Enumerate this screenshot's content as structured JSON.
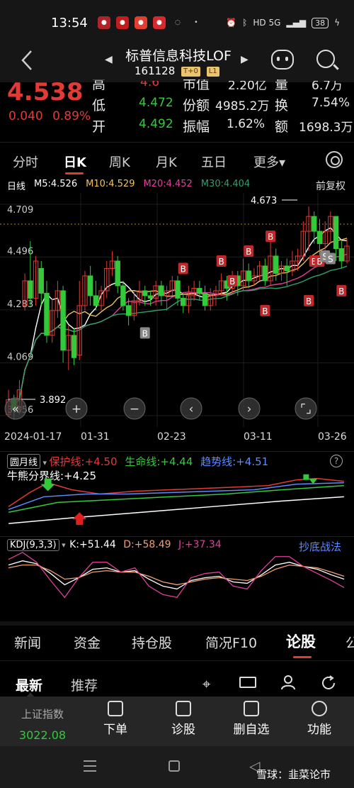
{
  "status": {
    "time": "13:54",
    "battery": "38",
    "right_text": "HD 5G"
  },
  "header": {
    "name": "标普信息科技LOF",
    "code": "161128",
    "tag1": "T+0",
    "tag2": "L1"
  },
  "quote": {
    "price": "4.538",
    "change": "0.040",
    "change_pct": "0.89%",
    "row0": [
      "高",
      "4.6",
      "市值",
      "2.20亿",
      "量",
      "6.7万"
    ],
    "low_label": "低",
    "low": "4.472",
    "amount_label": "份额",
    "amount": "4985.2万",
    "turnover_label": "换",
    "turnover": "7.54%",
    "open_label": "开",
    "open": "4.492",
    "amp_label": "振幅",
    "amp": "1.62%",
    "vol_label": "额",
    "vol": "1698.3万"
  },
  "tabs": [
    "分时",
    "日K",
    "周K",
    "月K",
    "五日",
    "更多▾"
  ],
  "ma": {
    "label": "日线",
    "m5": "M5:4.526",
    "m10": "M10:4.529",
    "m20": "M20:4.452",
    "m30": "M30:4.404",
    "adjust": "前复权"
  },
  "chart_data": {
    "type": "candlestick",
    "yticks": [
      "4.709",
      "4.496",
      "4.283",
      "4.069",
      "3.856"
    ],
    "xticks": [
      "2024-01-17",
      "01-31",
      "02-23",
      "03-11",
      "03-26"
    ],
    "high_mark": "4.673",
    "low_mark": "3.892",
    "candles": [
      [
        3.86,
        3.92,
        3.85,
        3.96
      ],
      [
        3.92,
        3.88,
        3.84,
        3.94
      ],
      [
        3.88,
        3.96,
        3.86,
        4.0
      ],
      [
        4.3,
        4.4,
        4.28,
        4.43
      ],
      [
        4.4,
        4.33,
        4.3,
        4.56
      ],
      [
        4.33,
        4.48,
        4.3,
        4.5
      ],
      [
        4.45,
        4.35,
        4.3,
        4.48
      ],
      [
        4.35,
        4.18,
        4.15,
        4.4
      ],
      [
        4.18,
        4.28,
        4.15,
        4.33
      ],
      [
        4.28,
        4.36,
        4.25,
        4.4
      ],
      [
        4.36,
        4.12,
        4.07,
        4.38
      ],
      [
        4.12,
        4.18,
        4.04,
        4.22
      ],
      [
        4.18,
        4.09,
        4.06,
        4.21
      ],
      [
        4.1,
        4.3,
        4.08,
        4.4
      ],
      [
        4.3,
        4.42,
        4.28,
        4.44
      ],
      [
        4.42,
        4.34,
        4.3,
        4.46
      ],
      [
        4.34,
        4.3,
        4.28,
        4.4
      ],
      [
        4.3,
        4.36,
        4.28,
        4.38
      ],
      [
        4.36,
        4.45,
        4.33,
        4.48
      ],
      [
        4.45,
        4.48,
        4.42,
        4.52
      ],
      [
        4.48,
        4.38,
        4.35,
        4.5
      ],
      [
        4.38,
        4.3,
        4.28,
        4.4
      ],
      [
        4.3,
        4.26,
        4.22,
        4.33
      ],
      [
        4.26,
        4.32,
        4.24,
        4.36
      ],
      [
        4.32,
        4.36,
        4.3,
        4.4
      ],
      [
        4.36,
        4.34,
        4.3,
        4.38
      ],
      [
        4.34,
        4.33,
        4.3,
        4.36
      ],
      [
        4.33,
        4.38,
        4.3,
        4.4
      ],
      [
        4.38,
        4.34,
        4.3,
        4.4
      ],
      [
        4.34,
        4.36,
        4.28,
        4.38
      ],
      [
        4.36,
        4.4,
        4.34,
        4.42
      ],
      [
        4.4,
        4.33,
        4.3,
        4.42
      ],
      [
        4.33,
        4.3,
        4.27,
        4.35
      ],
      [
        4.3,
        4.34,
        4.27,
        4.38
      ],
      [
        4.34,
        4.37,
        4.32,
        4.4
      ],
      [
        4.37,
        4.35,
        4.32,
        4.4
      ],
      [
        4.35,
        4.3,
        4.28,
        4.38
      ],
      [
        4.3,
        4.34,
        4.28,
        4.37
      ],
      [
        4.34,
        4.36,
        4.3,
        4.38
      ],
      [
        4.36,
        4.4,
        4.34,
        4.43
      ],
      [
        4.4,
        4.37,
        4.32,
        4.42
      ],
      [
        4.37,
        4.42,
        4.35,
        4.44
      ],
      [
        4.42,
        4.38,
        4.34,
        4.44
      ],
      [
        4.38,
        4.44,
        4.36,
        4.49
      ],
      [
        4.44,
        4.4,
        4.37,
        4.47
      ],
      [
        4.4,
        4.42,
        4.38,
        4.45
      ],
      [
        4.42,
        4.46,
        4.4,
        4.48
      ],
      [
        4.46,
        4.4,
        4.38,
        4.49
      ],
      [
        4.4,
        4.5,
        4.38,
        4.58
      ],
      [
        4.5,
        4.43,
        4.4,
        4.53
      ],
      [
        4.43,
        4.46,
        4.4,
        4.48
      ],
      [
        4.46,
        4.44,
        4.38,
        4.49
      ],
      [
        4.44,
        4.48,
        4.42,
        4.52
      ],
      [
        4.48,
        4.5,
        4.44,
        4.53
      ],
      [
        4.5,
        4.6,
        4.48,
        4.64
      ],
      [
        4.6,
        4.66,
        4.52,
        4.7
      ],
      [
        4.66,
        4.6,
        4.55,
        4.68
      ],
      [
        4.6,
        4.55,
        4.5,
        4.65
      ],
      [
        4.55,
        4.6,
        4.5,
        4.64
      ],
      [
        4.6,
        4.66,
        4.55,
        4.68
      ],
      [
        4.66,
        4.53,
        4.48,
        4.66
      ],
      [
        4.53,
        4.48,
        4.45,
        4.56
      ],
      [
        4.48,
        4.54,
        4.47,
        4.57
      ]
    ]
  },
  "controls": {
    "collapse": "«",
    "zoom_in": "+",
    "zoom_out": "−",
    "prev": "‹",
    "next": "›",
    "fullscreen": "⌜⌟"
  },
  "indicator1": {
    "name": "圆月线",
    "protect": "保护线:+4.50",
    "life": "生命线:+4.44",
    "trend": "趋势线:+4.51",
    "bull_bear": "牛熊分界线:+4.25",
    "help": "?"
  },
  "indicator2": {
    "name": "KDJ(9,3,3)",
    "k": "K:+51.44",
    "d": "D:+58.49",
    "j": "J:+37.34",
    "strategy": "抄底战法"
  },
  "news_tabs": [
    "新闻",
    "资金",
    "持仓股",
    "简况F10",
    "论股",
    "公"
  ],
  "sub_tabs": [
    "最新",
    "推荐"
  ],
  "bottom": {
    "index_name": "上证指数",
    "index_val": "3022.08",
    "buttons": [
      "下单",
      "诊股",
      "删自选",
      "功能"
    ]
  },
  "watermark": "雪球：韭菜论市",
  "colors": {
    "up": "#e23a36",
    "down": "#32c93b",
    "m5": "#ffffff",
    "m10": "#f0c060",
    "m20": "#e0409a",
    "m30": "#2fa06a"
  }
}
